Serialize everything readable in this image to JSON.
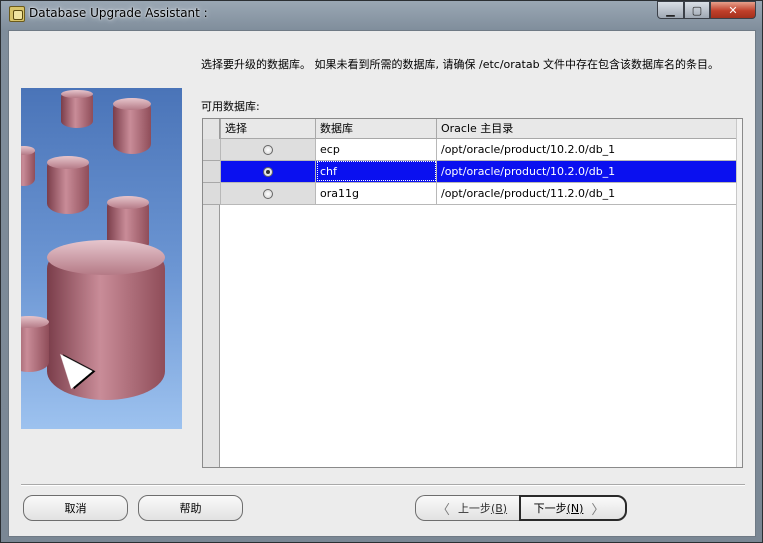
{
  "window": {
    "title": "Database Upgrade Assistant :",
    "controls": {
      "minimize": "▁",
      "maximize": "▢",
      "close": "✕"
    }
  },
  "page": {
    "instruction": "选择要升级的数据库。 如果未看到所需的数据库, 请确保 /etc/oratab 文件中存在包含该数据库名的条目。",
    "available_label": "可用数据库:"
  },
  "table": {
    "headers": [
      "选择",
      "数据库",
      "Oracle 主目录"
    ],
    "rows": [
      {
        "selected": false,
        "database": "ecp",
        "oracle_home": "/opt/oracle/product/10.2.0/db_1"
      },
      {
        "selected": true,
        "database": "chf",
        "oracle_home": "/opt/oracle/product/10.2.0/db_1"
      },
      {
        "selected": false,
        "database": "ora11g",
        "oracle_home": "/opt/oracle/product/11.2.0/db_1"
      }
    ]
  },
  "buttons": {
    "cancel": "取消",
    "help": "帮助",
    "back_text": "上一步",
    "back_mnemonic": "(B)",
    "next_text": "下一步",
    "next_mnemonic": "(N)"
  },
  "icons": {
    "back": "〈",
    "next": "〉"
  },
  "colors": {
    "selection": "#0a10f0",
    "close_button": "#c0402a"
  }
}
